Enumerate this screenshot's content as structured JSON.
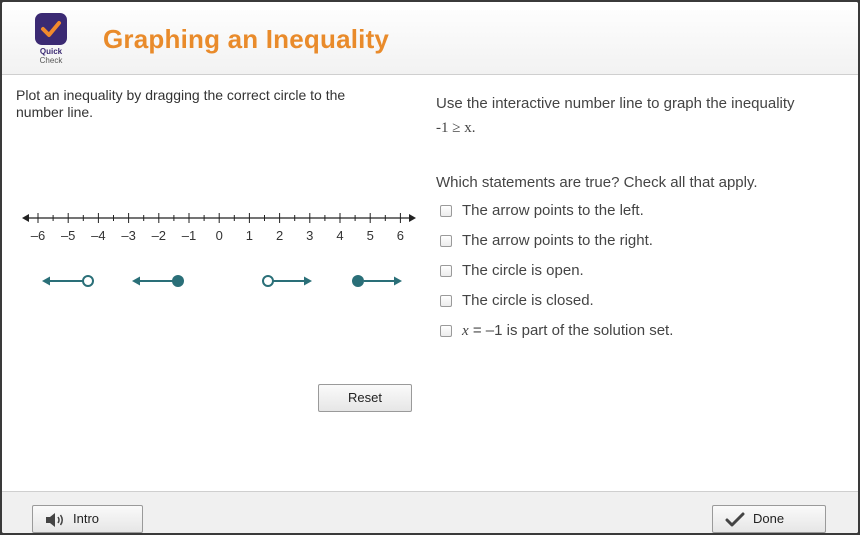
{
  "header": {
    "title": "Graphing an Inequality",
    "logo_line1": "Quick",
    "logo_line2": "Check"
  },
  "left": {
    "instructions": "Plot an inequality by dragging the correct circle to the number line.",
    "number_line_ticks": [
      "–6",
      "–5",
      "–4",
      "–3",
      "–2",
      "–1",
      "0",
      "1",
      "2",
      "3",
      "4",
      "5",
      "6"
    ],
    "reset_label": "Reset"
  },
  "right": {
    "prompt": "Use the interactive number line to graph the inequality",
    "inequality": "-1 ≥ x.",
    "question": "Which statements are true? Check all that apply.",
    "choices": [
      {
        "label": "The arrow points to the left."
      },
      {
        "label": "The arrow points to the right."
      },
      {
        "label": "The circle is open."
      },
      {
        "label": "The circle is closed."
      },
      {
        "label_var": "x",
        "label_rest": " = –1 is part of the solution set."
      }
    ]
  },
  "footer": {
    "intro_label": "Intro",
    "done_label": "Done"
  },
  "colors": {
    "title": "#e98b2b",
    "logo": "#3b2a73",
    "teal": "#2a6f78"
  }
}
